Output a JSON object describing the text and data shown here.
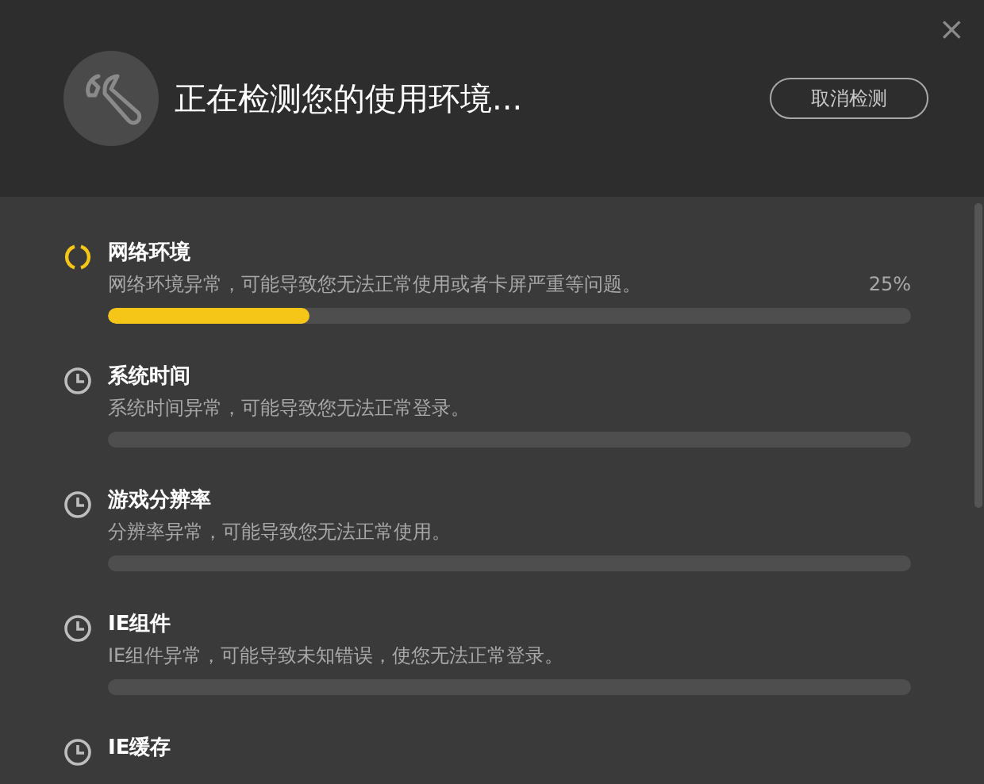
{
  "header": {
    "title": "正在检测您的使用环境...",
    "cancel_button": "取消检测",
    "close": "×"
  },
  "checks": [
    {
      "kind": "loading",
      "name": "网络环境",
      "description": "网络环境异常，可能导致您无法正常使用或者卡屏严重等问题。",
      "percent": "25%",
      "level": 0.25
    },
    {
      "kind": "waiting",
      "name": "系统时间",
      "description": "系统时间异常，可能导致您无法正常登录。"
    },
    {
      "kind": "waiting",
      "name": "游戏分辨率",
      "description": "分辨率异常，可能导致您无法正常使用。"
    },
    {
      "kind": "waiting",
      "name": "IE组件",
      "description": "IE组件异常，可能导致未知错误，使您无法正常登录。"
    },
    {
      "kind": "waiting",
      "name": "IE缓存"
    }
  ]
}
